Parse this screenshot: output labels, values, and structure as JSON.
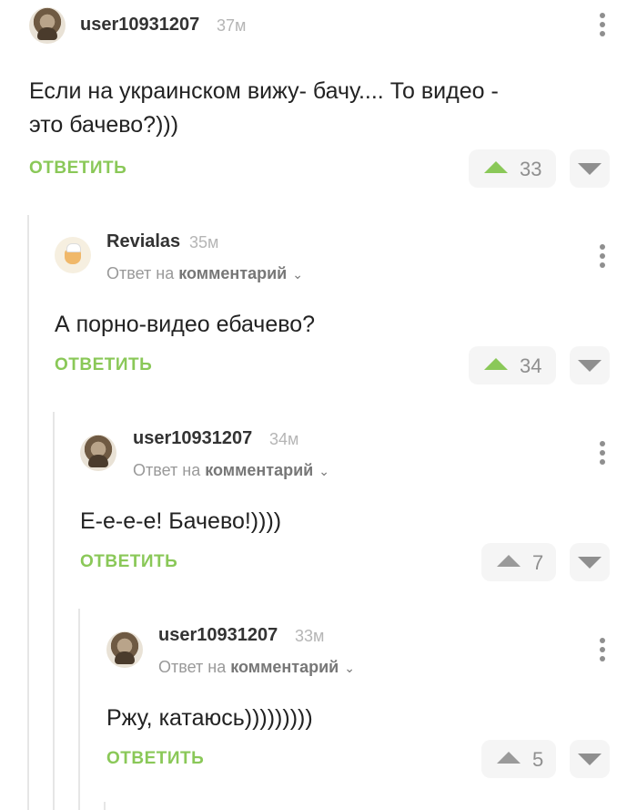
{
  "comments": [
    {
      "username": "user10931207",
      "time": "37м",
      "text_lines": [
        "Если на украинском вижу- бачу.... То видео -",
        "это бачево?)))"
      ],
      "reply_label": "ОТВЕТИТЬ",
      "votes": "33",
      "avatar": "user-avatar"
    },
    {
      "username": "Revialas",
      "time": "35м",
      "reply_prefix": "Ответ на",
      "reply_target": "комментарий",
      "text": "А порно-видео ебачево?",
      "reply_label": "ОТВЕТИТЬ",
      "votes": "34",
      "avatar": "revialas-avatar"
    },
    {
      "username": "user10931207",
      "time": "34м",
      "reply_prefix": "Ответ на",
      "reply_target": "комментарий",
      "text": "Е-е-е-е! Бачево!))))",
      "reply_label": "ОТВЕТИТЬ",
      "votes": "7",
      "avatar": "user-avatar"
    },
    {
      "username": "user10931207",
      "time": "33м",
      "reply_prefix": "Ответ на",
      "reply_target": "комментарий",
      "text": "Ржу, катаюсь)))))))))",
      "reply_label": "ОТВЕТИТЬ",
      "votes": "5",
      "avatar": "user-avatar"
    }
  ],
  "colors": {
    "accent_green": "#8ac858",
    "muted_gray": "#8f8f8f",
    "thread_line": "#e6e6e6"
  },
  "icons": [
    "more-vert-icon",
    "upvote-icon",
    "downvote-icon",
    "chevron-down-icon"
  ]
}
